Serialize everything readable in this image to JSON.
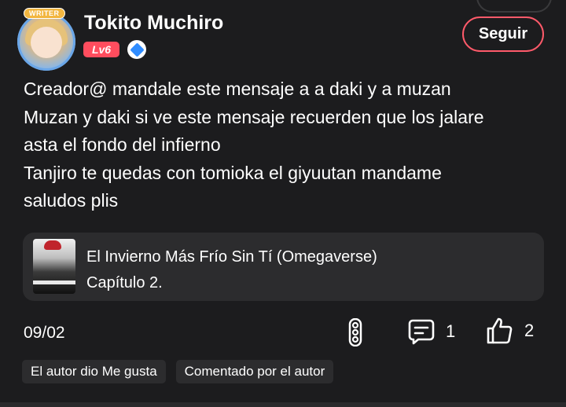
{
  "header": {
    "avatar_badge": "WRITER",
    "username": "Tokito Muchiro",
    "level": "Lv6",
    "follow_label": "Seguir"
  },
  "comment": {
    "lines": [
      "Creador@ mandale este mensaje a a daki y a muzan",
      "Muzan y daki si ve este mensaje recuerden que los jalare",
      "asta el fondo del infierno",
      "Tanjiro te quedas con tomioka el giyuutan mandame",
      "saludos plis"
    ]
  },
  "book": {
    "title": "El Invierno Más Frío Sin Tí (Omegaverse)",
    "chapter": "Capítulo 2."
  },
  "footer": {
    "date": "09/02",
    "comment_count": "1",
    "like_count": "2",
    "icons": {
      "more": "more-vertical-icon",
      "comments": "comment-bubble-icon",
      "likes": "thumbs-up-icon"
    }
  },
  "tags": [
    "El autor dio Me gusta",
    "Comentado por el autor"
  ],
  "colors": {
    "background": "#1c1c1e",
    "card": "#2c2c2e",
    "accent": "#ff5a6a",
    "level_badge": "#ff4d5e",
    "verified": "#2f8cff"
  }
}
